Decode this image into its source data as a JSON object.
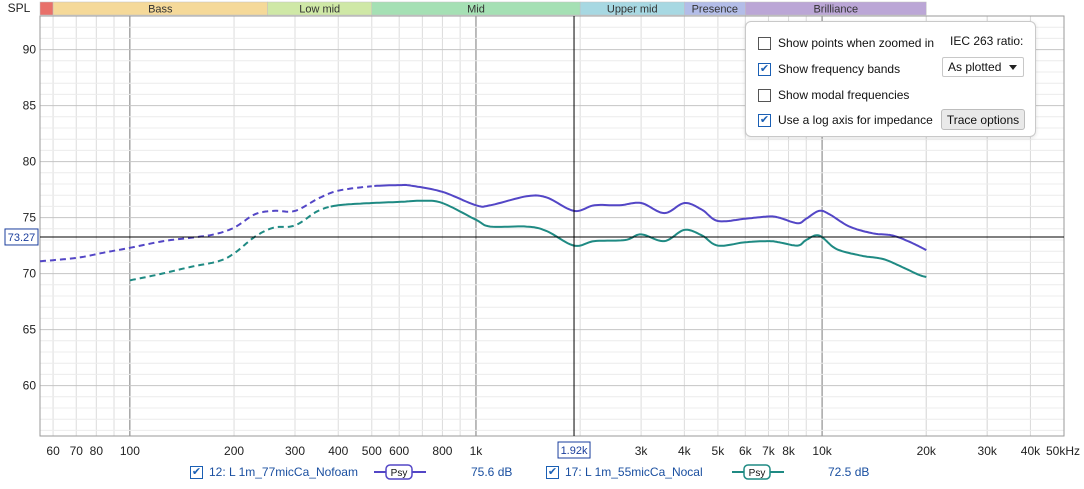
{
  "chart_data": {
    "type": "line",
    "ylabel": "SPL",
    "xscale": "log",
    "xlim": [
      55,
      50000
    ],
    "ylim": [
      55.5,
      93
    ],
    "yticks": [
      60,
      65,
      70,
      75,
      80,
      85,
      90
    ],
    "xticks": [
      {
        "v": 60,
        "label": "60"
      },
      {
        "v": 70,
        "label": "70"
      },
      {
        "v": 80,
        "label": "80"
      },
      {
        "v": 100,
        "label": "100"
      },
      {
        "v": 200,
        "label": "200"
      },
      {
        "v": 300,
        "label": "300"
      },
      {
        "v": 400,
        "label": "400"
      },
      {
        "v": 500,
        "label": "500"
      },
      {
        "v": 600,
        "label": "600"
      },
      {
        "v": 800,
        "label": "800"
      },
      {
        "v": 1000,
        "label": "1k"
      },
      {
        "v": 3000,
        "label": "3k"
      },
      {
        "v": 4000,
        "label": "4k"
      },
      {
        "v": 5000,
        "label": "5k"
      },
      {
        "v": 6000,
        "label": "6k"
      },
      {
        "v": 7000,
        "label": "7k"
      },
      {
        "v": 8000,
        "label": "8k"
      },
      {
        "v": 10000,
        "label": "10k"
      },
      {
        "v": 20000,
        "label": "20k"
      },
      {
        "v": 30000,
        "label": "30k"
      },
      {
        "v": 40000,
        "label": "40k"
      },
      {
        "v": 50000,
        "label": "50kHz"
      }
    ],
    "major_gridlines_x": [
      100,
      1000,
      10000
    ],
    "cursor": {
      "x": 1920,
      "x_label": "1.92k",
      "y": 73.27,
      "y_label": "73.27"
    },
    "bands": [
      {
        "name": "",
        "from": 55,
        "to": 60,
        "color": "#e8706a"
      },
      {
        "name": "Bass",
        "from": 60,
        "to": 250,
        "color": "#f5d999"
      },
      {
        "name": "Low mid",
        "from": 250,
        "to": 500,
        "color": "#cfe8a6"
      },
      {
        "name": "Mid",
        "from": 500,
        "to": 2000,
        "color": "#a5e0b4"
      },
      {
        "name": "Upper mid",
        "from": 2000,
        "to": 4000,
        "color": "#a7d8e2"
      },
      {
        "name": "Presence",
        "from": 4000,
        "to": 6000,
        "color": "#b3bde8"
      },
      {
        "name": "Brilliance",
        "from": 6000,
        "to": 20000,
        "color": "#bba6d6"
      }
    ],
    "series": [
      {
        "name": "12: L 1m_77micCa_Nofoam",
        "color": "#5346c6",
        "dashed_below": 500,
        "points": [
          [
            55,
            71.1
          ],
          [
            70,
            71.4
          ],
          [
            85,
            71.9
          ],
          [
            100,
            72.3
          ],
          [
            125,
            72.9
          ],
          [
            150,
            73.2
          ],
          [
            175,
            73.5
          ],
          [
            200,
            74.1
          ],
          [
            230,
            75.3
          ],
          [
            260,
            75.6
          ],
          [
            300,
            75.6
          ],
          [
            350,
            76.7
          ],
          [
            400,
            77.4
          ],
          [
            500,
            77.8
          ],
          [
            600,
            77.9
          ],
          [
            650,
            77.85
          ],
          [
            800,
            77.3
          ],
          [
            1000,
            76.1
          ],
          [
            1100,
            76.1
          ],
          [
            1400,
            76.9
          ],
          [
            1600,
            76.8
          ],
          [
            1920,
            75.6
          ],
          [
            2200,
            76.1
          ],
          [
            2600,
            76.1
          ],
          [
            3000,
            76.3
          ],
          [
            3500,
            75.4
          ],
          [
            4000,
            76.3
          ],
          [
            4500,
            75.7
          ],
          [
            5000,
            74.7
          ],
          [
            6000,
            74.9
          ],
          [
            7000,
            75.1
          ],
          [
            7500,
            75.0
          ],
          [
            8500,
            74.5
          ],
          [
            9000,
            74.9
          ],
          [
            9800,
            75.6
          ],
          [
            10500,
            75.3
          ],
          [
            12000,
            74.2
          ],
          [
            14000,
            73.6
          ],
          [
            16000,
            73.4
          ],
          [
            18000,
            72.8
          ],
          [
            20000,
            72.1
          ]
        ]
      },
      {
        "name": "17: L 1m_55micCa_Nocal",
        "color": "#1f8a83",
        "dashed_below": 380,
        "points": [
          [
            100,
            69.4
          ],
          [
            120,
            69.9
          ],
          [
            150,
            70.6
          ],
          [
            180,
            71.1
          ],
          [
            200,
            71.8
          ],
          [
            230,
            73.3
          ],
          [
            260,
            74.1
          ],
          [
            300,
            74.3
          ],
          [
            350,
            75.6
          ],
          [
            400,
            76.1
          ],
          [
            500,
            76.3
          ],
          [
            600,
            76.4
          ],
          [
            700,
            76.5
          ],
          [
            800,
            76.3
          ],
          [
            1000,
            74.8
          ],
          [
            1100,
            74.2
          ],
          [
            1400,
            74.2
          ],
          [
            1600,
            73.8
          ],
          [
            1920,
            72.5
          ],
          [
            2200,
            72.9
          ],
          [
            2700,
            73.0
          ],
          [
            3000,
            73.5
          ],
          [
            3500,
            72.9
          ],
          [
            4000,
            73.9
          ],
          [
            4500,
            73.4
          ],
          [
            5000,
            72.5
          ],
          [
            6000,
            72.8
          ],
          [
            7000,
            72.9
          ],
          [
            7500,
            72.8
          ],
          [
            8500,
            72.5
          ],
          [
            9000,
            73.0
          ],
          [
            9800,
            73.4
          ],
          [
            11000,
            72.2
          ],
          [
            13000,
            71.6
          ],
          [
            15000,
            71.3
          ],
          [
            17000,
            70.6
          ],
          [
            19000,
            69.9
          ],
          [
            20000,
            69.7
          ]
        ]
      }
    ]
  },
  "options_panel": {
    "show_points_label": "Show points when zoomed in",
    "show_points_checked": false,
    "show_bands_label": "Show frequency bands",
    "show_bands_checked": true,
    "show_modal_label": "Show modal frequencies",
    "show_modal_checked": false,
    "log_impedance_label": "Use a log axis for impedance",
    "log_impedance_checked": true,
    "iec_label": "IEC 263 ratio:",
    "iec_value": "As plotted",
    "trace_button": "Trace options"
  },
  "legend": [
    {
      "checked": true,
      "name": "12: L 1m_77micCa_Nofoam",
      "badge": "Psy",
      "value": "75.6 dB",
      "color": "#5346c6"
    },
    {
      "checked": true,
      "name": "17: L 1m_55micCa_Nocal",
      "badge": "Psy",
      "value": "72.5 dB",
      "color": "#1f8a83"
    }
  ]
}
